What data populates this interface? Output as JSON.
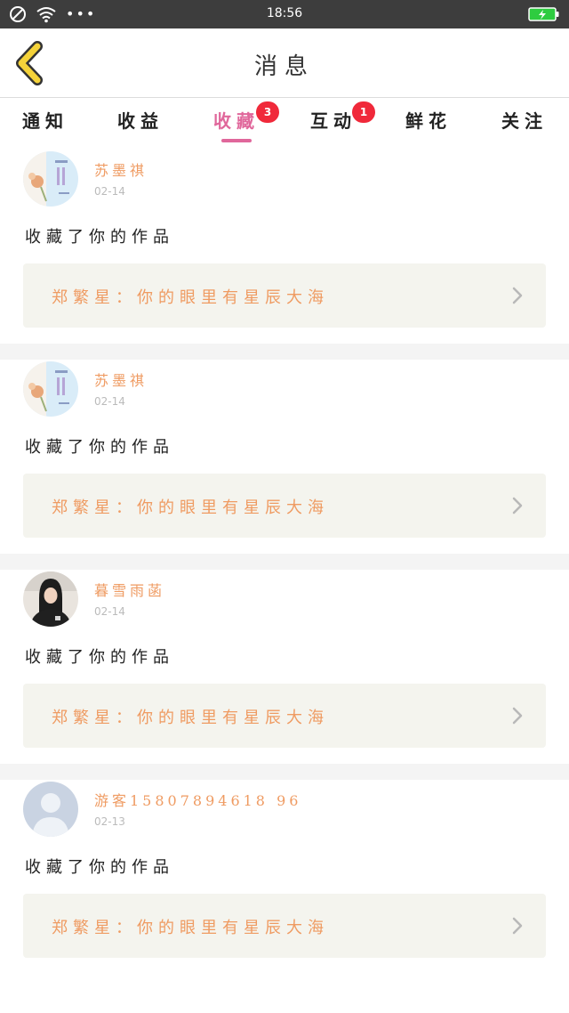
{
  "status_bar": {
    "time": "18:56",
    "icons": [
      "no-disturb-icon",
      "wifi-icon",
      "more-dots-icon",
      "battery-charging-icon"
    ],
    "dots": "•••"
  },
  "header": {
    "title": "消息",
    "back_icon": "chevron-left-icon",
    "back_icon_color": "#f5d33a"
  },
  "tabs": [
    {
      "label": "通知",
      "active": false,
      "badge": ""
    },
    {
      "label": "收益",
      "active": false,
      "badge": ""
    },
    {
      "label": "收藏",
      "active": true,
      "badge": "3"
    },
    {
      "label": "互动",
      "active": false,
      "badge": "1"
    },
    {
      "label": "鲜花",
      "active": false,
      "badge": ""
    },
    {
      "label": "关注",
      "active": false,
      "badge": ""
    }
  ],
  "colors": {
    "accent_pink": "#e0679b",
    "accent_orange": "#ef9b62",
    "badge_red": "#f0293a",
    "status_bar_bg": "#3d3d3d",
    "link_bg": "#f4f4ee"
  },
  "messages": [
    {
      "user": "苏墨祺",
      "date": "02-14",
      "action": "收藏了你的作品",
      "work": "郑繁星：你的眼里有星辰大海",
      "avatar": "flower-book-cover"
    },
    {
      "user": "苏墨祺",
      "date": "02-14",
      "action": "收藏了你的作品",
      "work": "郑繁星：你的眼里有星辰大海",
      "avatar": "flower-book-cover"
    },
    {
      "user": "暮雪雨菡",
      "date": "02-14",
      "action": "收藏了你的作品",
      "work": "郑繁星：你的眼里有星辰大海",
      "avatar": "woman-photo"
    },
    {
      "user": "游客15807894618 96",
      "date": "02-13",
      "action": "收藏了你的作品",
      "work": "郑繁星：你的眼里有星辰大海",
      "avatar": "default-user-avatar"
    }
  ]
}
